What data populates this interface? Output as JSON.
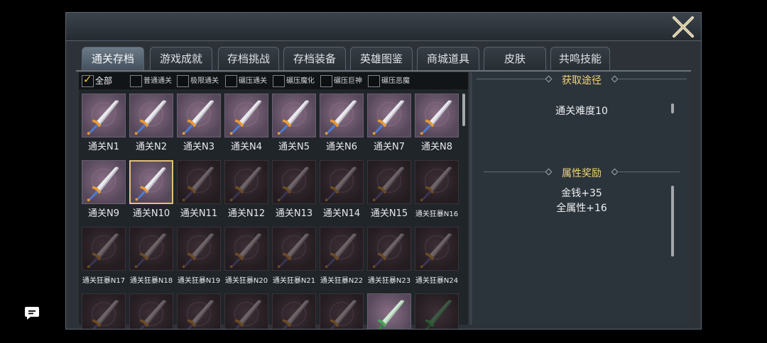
{
  "tabs": [
    "通关存档",
    "游戏成就",
    "存档挑战",
    "存档装备",
    "英雄图鉴",
    "商城道具",
    "皮肤",
    "共鸣技能"
  ],
  "active_tab": 0,
  "filters": [
    {
      "label": "全部",
      "checked": true
    },
    {
      "label": "普通通关",
      "checked": false
    },
    {
      "label": "极限通关",
      "checked": false
    },
    {
      "label": "碾压通关",
      "checked": false
    },
    {
      "label": "碾压魔化",
      "checked": false
    },
    {
      "label": "碾压巨神",
      "checked": false
    },
    {
      "label": "碾压恶魔",
      "checked": false
    }
  ],
  "items": [
    {
      "label": "通关N1",
      "state": "unlocked"
    },
    {
      "label": "通关N2",
      "state": "unlocked"
    },
    {
      "label": "通关N3",
      "state": "unlocked"
    },
    {
      "label": "通关N4",
      "state": "unlocked"
    },
    {
      "label": "通关N5",
      "state": "unlocked"
    },
    {
      "label": "通关N6",
      "state": "unlocked"
    },
    {
      "label": "通关N7",
      "state": "unlocked"
    },
    {
      "label": "通关N8",
      "state": "unlocked"
    },
    {
      "label": "通关N9",
      "state": "unlocked"
    },
    {
      "label": "通关N10",
      "state": "selected"
    },
    {
      "label": "通关N11",
      "state": "locked"
    },
    {
      "label": "通关N12",
      "state": "locked"
    },
    {
      "label": "通关N13",
      "state": "locked"
    },
    {
      "label": "通关N14",
      "state": "locked"
    },
    {
      "label": "通关N15",
      "state": "locked"
    },
    {
      "label": "通关狂暴N16",
      "state": "locked"
    },
    {
      "label": "通关狂暴N17",
      "state": "locked"
    },
    {
      "label": "通关狂暴N18",
      "state": "locked"
    },
    {
      "label": "通关狂暴N19",
      "state": "locked"
    },
    {
      "label": "通关狂暴N20",
      "state": "locked"
    },
    {
      "label": "通关狂暴N21",
      "state": "locked"
    },
    {
      "label": "通关狂暴N22",
      "state": "locked"
    },
    {
      "label": "通关狂暴N23",
      "state": "locked"
    },
    {
      "label": "通关狂暴N24",
      "state": "locked"
    },
    {
      "label": "",
      "state": "locked"
    },
    {
      "label": "",
      "state": "locked"
    },
    {
      "label": "",
      "state": "locked"
    },
    {
      "label": "",
      "state": "locked"
    },
    {
      "label": "",
      "state": "locked"
    },
    {
      "label": "",
      "state": "locked"
    },
    {
      "label": "",
      "state": "jade"
    },
    {
      "label": "",
      "state": "jade-locked"
    }
  ],
  "details": {
    "source_title": "获取途径",
    "source_text": "通关难度10",
    "reward_title": "属性奖励",
    "reward_lines": [
      "金钱+35",
      "全属性+16"
    ]
  },
  "colors": {
    "accent_gold": "#f0d37a",
    "selected_border": "#e2c07a",
    "check_yellow": "#f0c234"
  },
  "icons": {
    "close": "close-x-icon",
    "chat": "chat-bubble-icon",
    "item": "sword-icon"
  }
}
